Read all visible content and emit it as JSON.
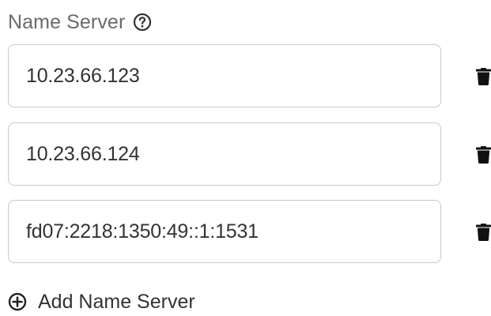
{
  "name_server": {
    "label": "Name Server",
    "help_icon": "help-circle-icon",
    "entries": [
      {
        "value": "10.23.66.123",
        "delete_icon": "trash-icon"
      },
      {
        "value": "10.23.66.124",
        "delete_icon": "trash-icon"
      },
      {
        "value": "fd07:2218:1350:49::1:1531",
        "delete_icon": "trash-icon"
      }
    ],
    "add_label": "Add Name Server",
    "add_icon": "plus-circle-icon"
  }
}
